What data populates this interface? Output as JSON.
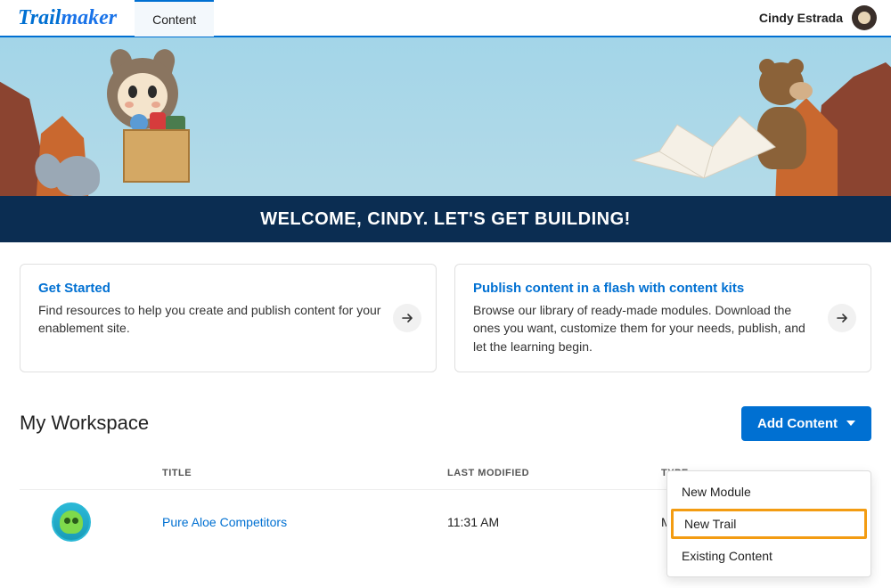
{
  "header": {
    "logo_part1": "Trail",
    "logo_part2": "maker",
    "tab": "Content",
    "user_name": "Cindy Estrada"
  },
  "hero": {
    "welcome": "WELCOME, CINDY. LET'S GET BUILDING!"
  },
  "cards": [
    {
      "title": "Get Started",
      "body": "Find resources to help you create and publish content for your enablement site."
    },
    {
      "title": "Publish content in a flash with content kits",
      "body": "Browse our library of ready-made modules. Download the ones you want, customize them for your needs, publish, and let the learning begin."
    }
  ],
  "workspace": {
    "title": "My Workspace",
    "add_button": "Add Content",
    "columns": {
      "title": "TITLE",
      "modified": "LAST MODIFIED",
      "type": "TYPE"
    },
    "rows": [
      {
        "title": "Pure Aloe Competitors",
        "modified": "11:31 AM",
        "type": "Modul"
      }
    ]
  },
  "dropdown": {
    "items": [
      "New Module",
      "New Trail",
      "Existing Content"
    ],
    "highlighted_index": 1
  }
}
